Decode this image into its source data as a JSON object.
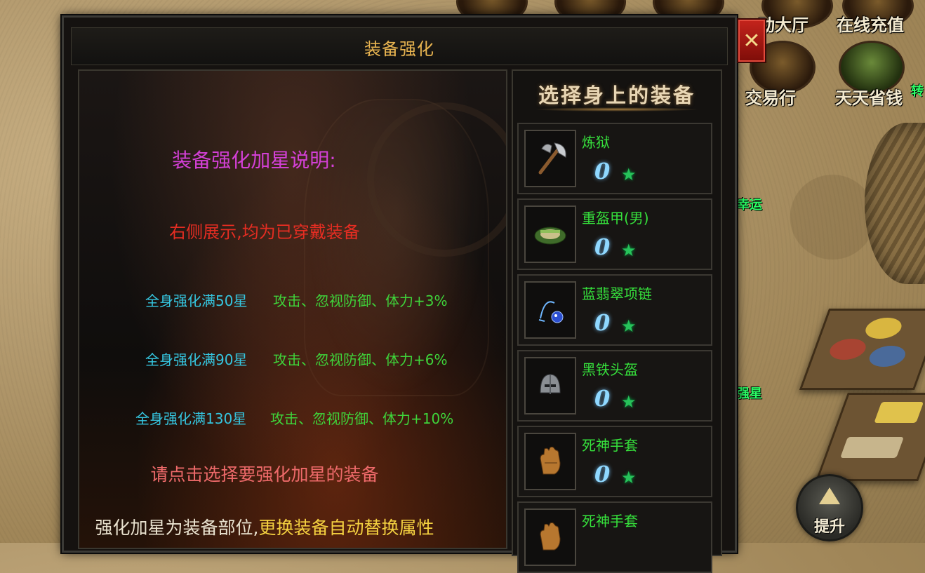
{
  "window": {
    "title": "装备强化",
    "close_label": "✕"
  },
  "info": {
    "heading": "装备强化加星说明:",
    "notice": "右侧展示,均为已穿戴装备",
    "tiers": [
      {
        "label": "全身强化满50星",
        "bonus": "攻击、忽视防御、体力+3%"
      },
      {
        "label": "全身强化满90星",
        "bonus": "攻击、忽视防御、体力+6%"
      },
      {
        "label": "全身强化满130星",
        "bonus": "攻击、忽视防御、体力+10%"
      }
    ],
    "hint": "请点击选择要强化加星的装备",
    "footer_part1": "强化加星为装备部位,",
    "footer_part2": "更换装备自动替换属性"
  },
  "equipment_panel": {
    "header": "选择身上的装备",
    "items": [
      {
        "name": "炼狱",
        "stars": "0",
        "icon": "axe-icon"
      },
      {
        "name": "重盔甲(男)",
        "stars": "0",
        "icon": "armor-icon"
      },
      {
        "name": "蓝翡翠项链",
        "stars": "0",
        "icon": "necklace-icon"
      },
      {
        "name": "黑铁头盔",
        "stars": "0",
        "icon": "helmet-icon"
      },
      {
        "name": "死神手套",
        "stars": "0",
        "icon": "glove-icon"
      },
      {
        "name": "死神手套",
        "stars": "",
        "icon": "glove-icon"
      }
    ]
  },
  "hud": {
    "top_labels": [
      "动大厅",
      "在线充值"
    ],
    "second_labels": [
      "交易行",
      "天天省钱"
    ],
    "upgrade_label": "提升",
    "side_texts": [
      "幸运",
      "强星",
      "转"
    ]
  },
  "colors": {
    "title": "#e8b450",
    "heading": "#d340d6",
    "notice": "#e52d22",
    "tier_label": "#35c6e0",
    "tier_bonus": "#3fd43a",
    "hint": "#ee6a6a",
    "item_name": "#36e23c",
    "close_button": "#c5241c"
  }
}
